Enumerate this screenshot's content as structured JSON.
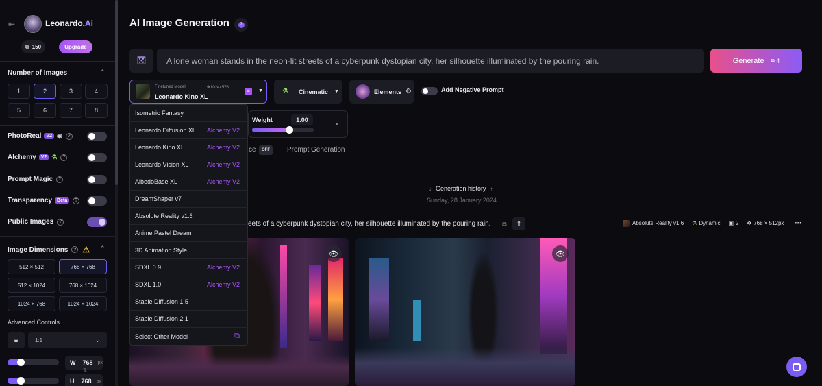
{
  "brand": {
    "name": "Leonardo.",
    "suffix": "Ai"
  },
  "tokens": {
    "count": "150",
    "upgrade": "Upgrade"
  },
  "sidebar": {
    "number_of_images": {
      "title": "Number of Images",
      "options": [
        "1",
        "2",
        "3",
        "4",
        "5",
        "6",
        "7",
        "8"
      ],
      "selected": "2"
    },
    "toggles": [
      {
        "label": "PhotoReal",
        "badge": "V2",
        "on": false
      },
      {
        "label": "Alchemy",
        "badge": "V2",
        "on": false
      },
      {
        "label": "Prompt Magic",
        "badge": "",
        "on": false
      },
      {
        "label": "Transparency",
        "badge": "Beta",
        "on": false
      },
      {
        "label": "Public Images",
        "badge": "",
        "on": true
      }
    ],
    "image_dimensions": {
      "title": "Image Dimensions",
      "options": [
        "512 × 512",
        "768 × 768",
        "512 × 1024",
        "768 × 1024",
        "1024 × 768",
        "1024 × 1024"
      ],
      "selected": "768 × 768"
    },
    "advanced_controls": "Advanced Controls",
    "aspect_ratio": "1:1",
    "width": {
      "label": "W",
      "value": "768",
      "unit": "px"
    },
    "height": {
      "label": "H",
      "value": "768",
      "unit": "px"
    }
  },
  "header": {
    "title": "AI Image Generation"
  },
  "prompt": {
    "text": "A lone woman stands in the neon-lit streets of a cyberpunk dystopian city, her silhouette illuminated by the pouring rain."
  },
  "generate": {
    "label": "Generate",
    "cost": "4"
  },
  "model": {
    "caption": "Finetuned Model",
    "name": "Leonardo Kino XL",
    "size": "1024×576"
  },
  "style": {
    "label": "Cinematic"
  },
  "elements": {
    "label": "Elements"
  },
  "negative_prompt": {
    "label": "Add Negative Prompt"
  },
  "weight": {
    "label": "Weight",
    "value": "1.00",
    "fraction": 0.6
  },
  "tabs": {
    "partial": "ce",
    "off": "OFF",
    "prompt_generation": "Prompt Generation"
  },
  "model_dropdown": {
    "items": [
      {
        "name": "Isometric Fantasy",
        "tag": ""
      },
      {
        "name": "Leonardo Diffusion XL",
        "tag": "Alchemy V2"
      },
      {
        "name": "Leonardo Kino XL",
        "tag": "Alchemy V2"
      },
      {
        "name": "Leonardo Vision XL",
        "tag": "Alchemy V2"
      },
      {
        "name": "AlbedoBase XL",
        "tag": "Alchemy V2"
      },
      {
        "name": "DreamShaper v7",
        "tag": ""
      },
      {
        "name": "Absolute Reality v1.6",
        "tag": ""
      },
      {
        "name": "Anime Pastel Dream",
        "tag": ""
      },
      {
        "name": "3D Animation Style",
        "tag": ""
      },
      {
        "name": "SDXL 0.9",
        "tag": "Alchemy V2"
      },
      {
        "name": "SDXL 1.0",
        "tag": "Alchemy V2"
      },
      {
        "name": "Stable Diffusion 1.5",
        "tag": ""
      },
      {
        "name": "Stable Diffusion 2.1",
        "tag": ""
      }
    ],
    "other": "Select Other Model"
  },
  "history": {
    "title": "Generation history",
    "date": "Sunday, 28 January 2024"
  },
  "generation": {
    "prompt_partial": "eets of a cyberpunk dystopian city, her silhouette illuminated by the pouring rain.",
    "model": "Absolute Reality v1.6",
    "style": "Dynamic",
    "count": "2",
    "size": "768 × 512px",
    "more": "···"
  },
  "colors": {
    "accent": "#e8508a",
    "accent2": "#7b5cf0",
    "alchemy": "#a558f2",
    "background": "#0b0b10"
  }
}
